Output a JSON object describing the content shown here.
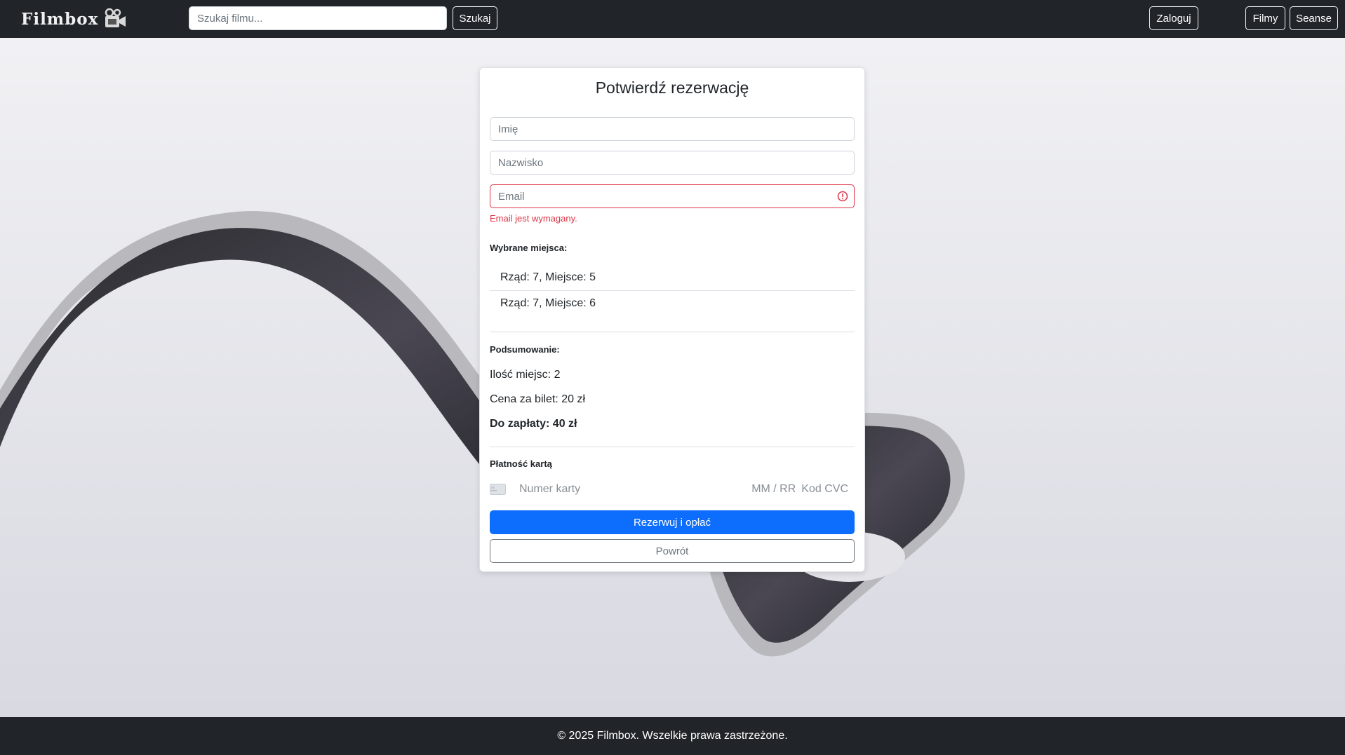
{
  "navbar": {
    "logo_text": "Filmbox",
    "search_placeholder": "Szukaj filmu...",
    "search_button": "Szukaj",
    "login_button": "Zaloguj",
    "films_link": "Filmy",
    "screenings_link": "Seanse"
  },
  "reservation": {
    "title": "Potwierdź rezerwację",
    "first_name_placeholder": "Imię",
    "last_name_placeholder": "Nazwisko",
    "email_placeholder": "Email",
    "email_error": "Email jest wymagany.",
    "seats_label": "Wybrane miejsca:",
    "seats": [
      "Rząd: 7, Miejsce: 5",
      "Rząd: 7, Miejsce: 6"
    ],
    "summary_label": "Podsumowanie:",
    "seat_count": "Ilość miejsc: 2",
    "ticket_price": "Cena za bilet: 20 zł",
    "total": "Do zapłaty: 40 zł",
    "payment_label": "Płatność kartą",
    "card_number_placeholder": "Numer karty",
    "card_expiry_placeholder": "MM / RR",
    "card_cvc_placeholder": "Kod CVC",
    "submit_button": "Rezerwuj i opłać",
    "back_button": "Powrót"
  },
  "footer": {
    "text": "© 2025 Filmbox. Wszelkie prawa zastrzeżone."
  },
  "colors": {
    "navbar": "#212529",
    "primary": "#0d6efd",
    "error": "#dc3545"
  }
}
